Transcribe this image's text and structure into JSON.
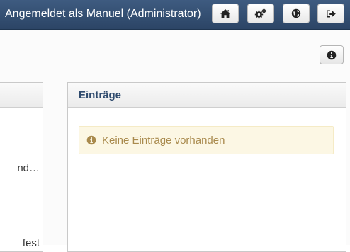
{
  "header": {
    "title": "Angemeldet als Manuel (Administrator)",
    "buttons": [
      {
        "icon": "home-icon"
      },
      {
        "icon": "gears-icon"
      },
      {
        "icon": "globe-icon"
      },
      {
        "icon": "logout-icon"
      }
    ]
  },
  "toolbar": {
    "info_icon": "info-icon"
  },
  "left_panel": {
    "lines": [
      "nd…",
      "fest"
    ]
  },
  "entries_panel": {
    "title": "Einträge",
    "empty_message": "Keine Einträge vorhanden"
  },
  "colors": {
    "header_bg": "#34506f",
    "panel_title": "#2f4b6e",
    "alert_bg": "#fcf7e4",
    "alert_text": "#a98a4d"
  }
}
